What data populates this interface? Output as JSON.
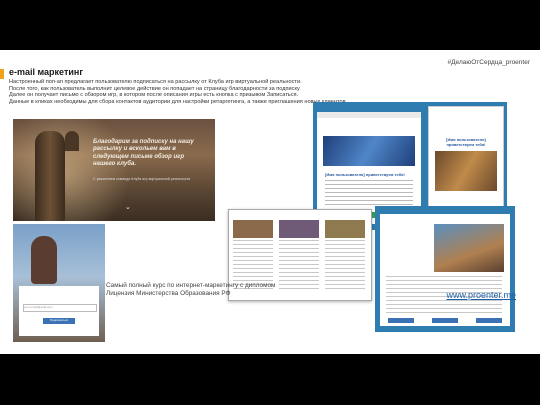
{
  "slide": {
    "tag": "#ДелаюОтСердца_proenter",
    "title": "e-mail маркетинг",
    "description": [
      "Настроенный поп-ап предлагает пользователю подписаться на рассылку от Клуба игр виртуальной реальности.",
      "После того, как пользователь выполнит целевое действие он попадает на страницу благодарности за подписку",
      "Далее он получает письмо с обзором игр, в котором после описания игры есть кнопка с призывом Записаться.",
      "Данные в кликах необходимы для сбора контактов аудитории для настройки ретаргетинга, а также приглашения новых клиентов."
    ],
    "hero_message": "Благодарим за подписку на нашу рассылку и вскольем вам в следующем письме обзор игр нашего клуба.",
    "hero_small": "С уважением команда Клуба игр виртуальной реальности",
    "email_caption": "[Имя пользователя] приветствуем тебя!",
    "phone_caption": "[Имя пользователя] приветствуем тебя!",
    "form_placeholder": "your.email@mail.com",
    "form_button": "Подписаться",
    "footer_line1": "Самый полный курс по интернет-маркетингу с дипломом",
    "footer_line2": "Лицензия Министерства Образования РФ",
    "url": "www.proenter.me"
  },
  "colors": {
    "accent": "#f0a318",
    "link": "#1e5fa6",
    "email_bg": "#2f7db0"
  }
}
